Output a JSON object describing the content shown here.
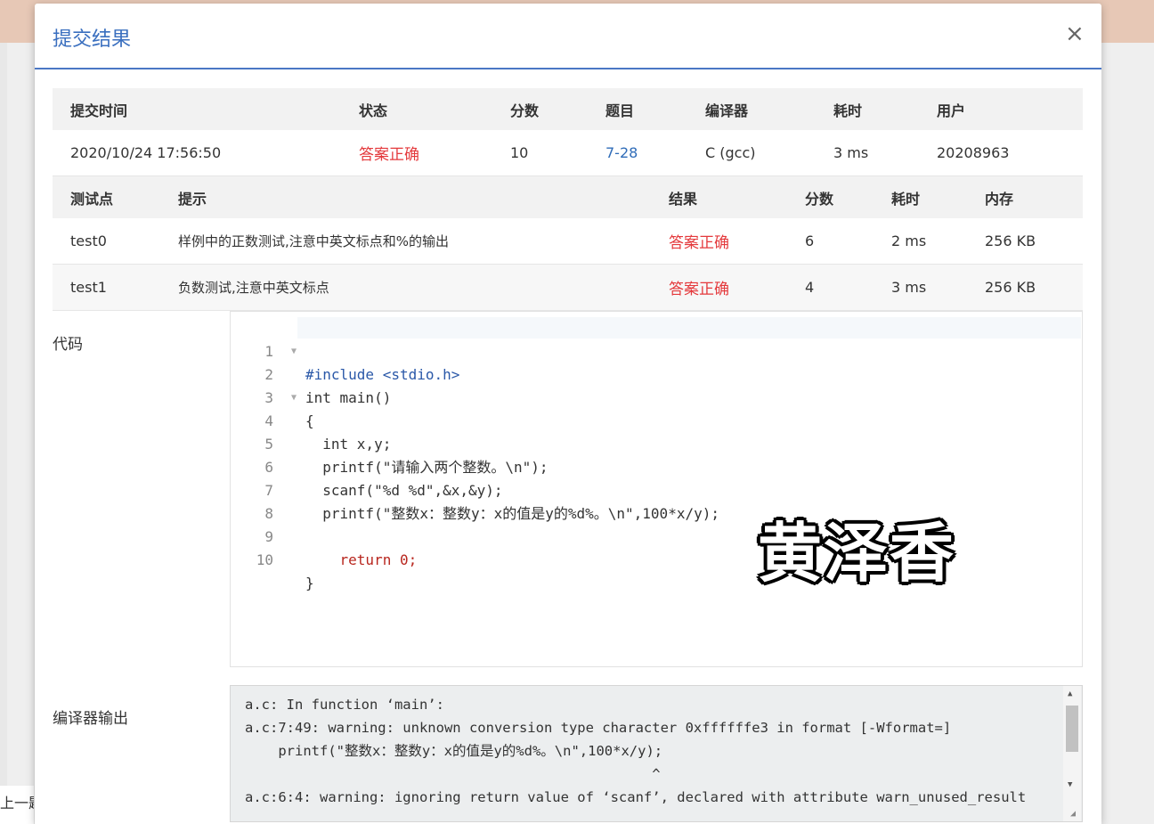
{
  "background": {
    "prev_label": "上一题"
  },
  "modal": {
    "title": "提交结果",
    "close": "×"
  },
  "submission": {
    "headers": [
      "提交时间",
      "状态",
      "分数",
      "题目",
      "编译器",
      "耗时",
      "用户"
    ],
    "row": {
      "time": "2020/10/24 17:56:50",
      "status": "答案正确",
      "score": "10",
      "problem": "7-28",
      "compiler": "C (gcc)",
      "elapsed": "3 ms",
      "user": "20208963"
    }
  },
  "tests": {
    "headers": [
      "测试点",
      "提示",
      "结果",
      "分数",
      "耗时",
      "内存"
    ],
    "rows": [
      {
        "name": "test0",
        "hint": "样例中的正数测试,注意中英文标点和%的输出",
        "result": "答案正确",
        "score": "6",
        "time": "2 ms",
        "memory": "256 KB"
      },
      {
        "name": "test1",
        "hint": "负数测试,注意中英文标点",
        "result": "答案正确",
        "score": "4",
        "time": "3 ms",
        "memory": "256 KB"
      }
    ]
  },
  "code": {
    "label": "代码",
    "lines": [
      "#include <stdio.h>",
      "int main()",
      "{",
      "  int x,y;",
      "  printf(\"请输入两个整数。\\n\");",
      "  scanf(\"%d %d\",&x,&y);",
      "  printf(\"整数x：整数y：x的值是y的%d%。\\n\",100*x/y);",
      "    ",
      "    return 0;",
      "}"
    ]
  },
  "watermark": "黄泽香",
  "compiler_output": {
    "label": "编译器输出",
    "lines": [
      "a.c: In function ‘main’:",
      "a.c:7:49: warning: unknown conversion type character 0xffffffe3 in format [-Wformat=]",
      "    printf(\"整数x：整数y：x的值是y的%d%。\\n\",100*x/y);",
      "                                                 ^",
      "a.c:6:4: warning: ignoring return value of ‘scanf’, declared with attribute warn_unused_result"
    ]
  }
}
